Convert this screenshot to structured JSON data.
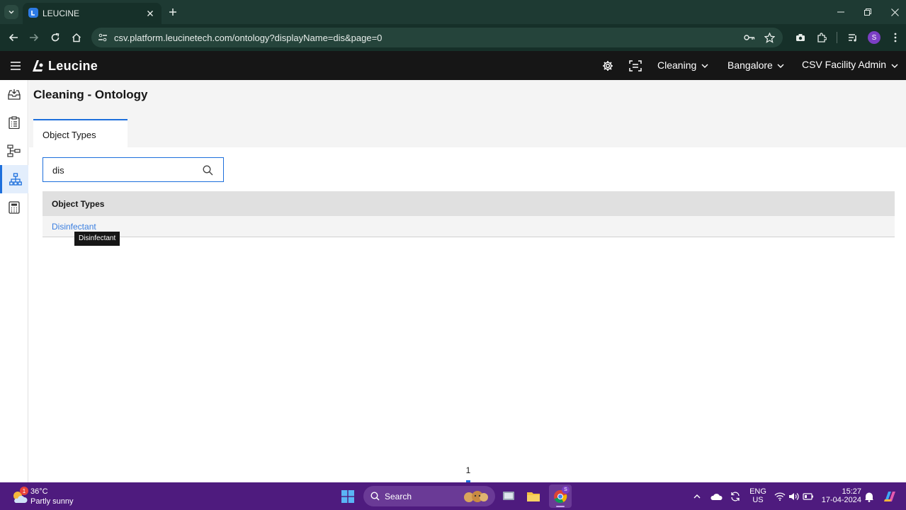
{
  "browser": {
    "tab_title": "LEUCINE",
    "url": "csv.platform.leucinetech.com/ontology?displayName=dis&page=0",
    "profile_initial": "S"
  },
  "header": {
    "brand": "Leucine",
    "use_case": "Cleaning",
    "facility": "Bangalore",
    "role": "CSV Facility Admin"
  },
  "page": {
    "title": "Cleaning - Ontology",
    "tab_label": "Object Types",
    "search_value": "dis",
    "table_header": "Object Types",
    "rows": [
      "Disinfectant"
    ],
    "tooltip": "Disinfectant",
    "pagination_current": "1"
  },
  "taskbar": {
    "weather_temp": "36°C",
    "weather_desc": "Partly sunny",
    "weather_badge": "1",
    "search_label": "Search",
    "lang_line1": "ENG",
    "lang_line2": "US",
    "time": "15:27",
    "date": "17-04-2024"
  },
  "colors": {
    "accent": "#1d6fdc",
    "link": "#3b7fe0",
    "taskbar": "#4e1b7e",
    "chrome": "#163029"
  }
}
